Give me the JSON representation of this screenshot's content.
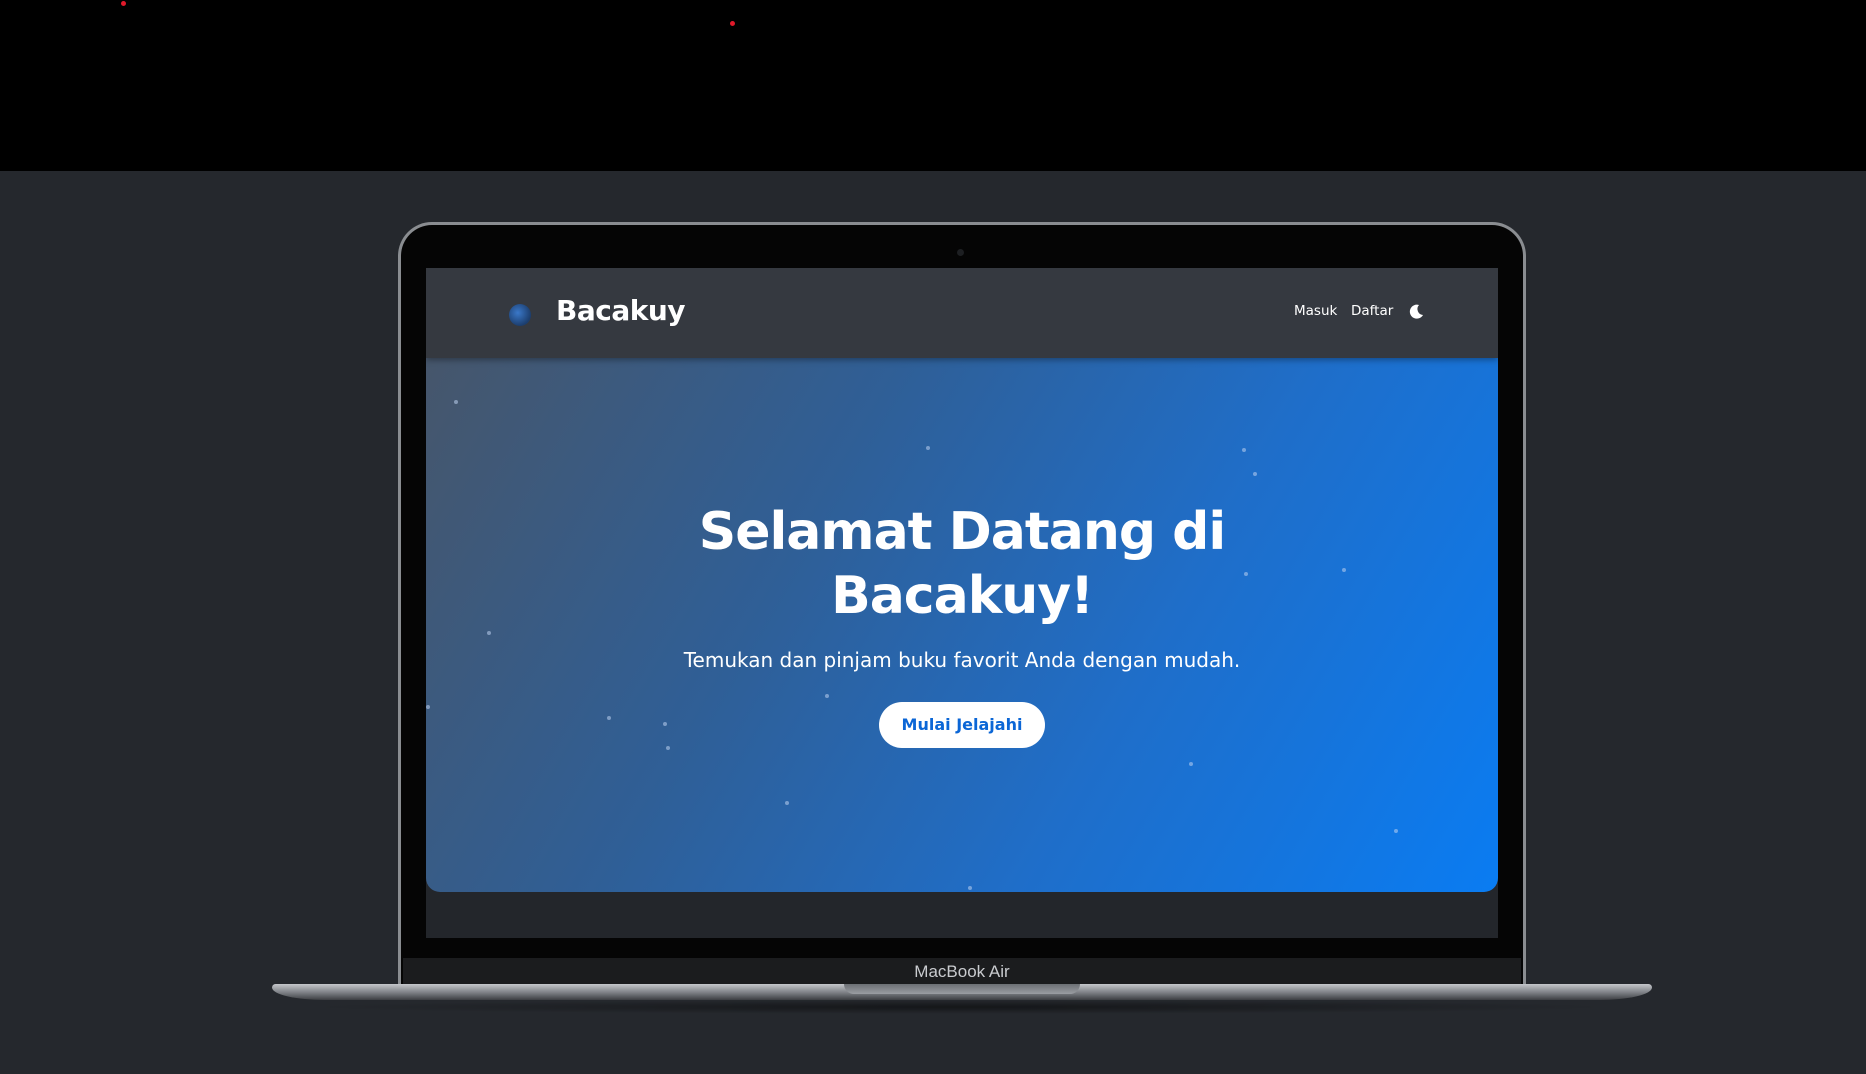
{
  "app": {
    "brand": "Bacakuy",
    "logo_icon": "book-globe-icon"
  },
  "nav": {
    "login_label": "Masuk",
    "register_label": "Daftar",
    "theme_toggle_icon": "moon-icon"
  },
  "hero": {
    "title_line1": "Selamat Datang di",
    "title_line2": "Bacakuy!",
    "subtitle": "Temukan dan pinjam buku favorit Anda dengan mudah.",
    "cta_label": "Mulai Jelajahi"
  },
  "device": {
    "label": "MacBook Air"
  },
  "colors": {
    "navbar": "#353940",
    "hero_gradient_start": "#46566b",
    "hero_gradient_end": "#0a7cf2",
    "cta_text": "#0b66d6",
    "page_background": "#25282d"
  }
}
